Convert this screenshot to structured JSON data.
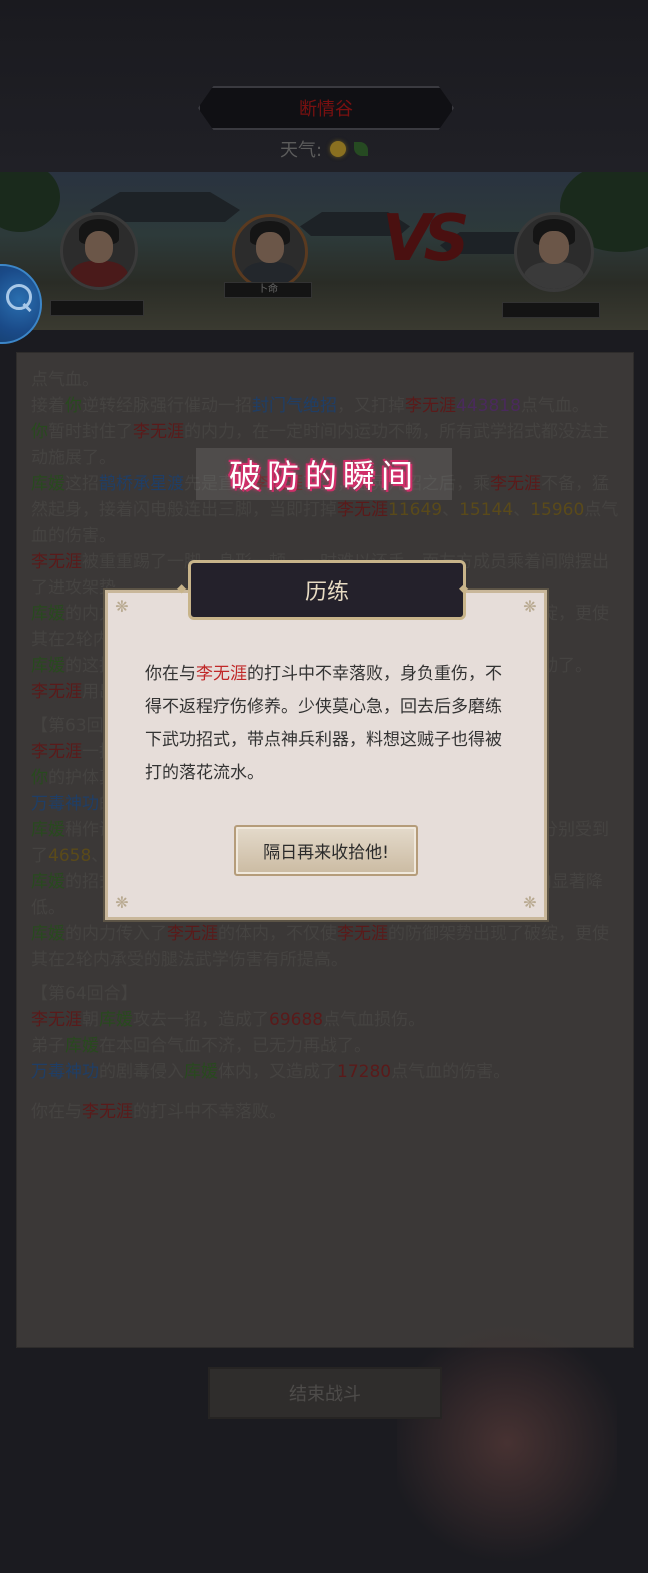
{
  "header": {
    "location": "断情谷",
    "weather_label": "天气:",
    "weather_icons": [
      "sun-icon",
      "leaf-icon"
    ]
  },
  "battle": {
    "ally_name_tag": "卜命",
    "vs_label": "VS"
  },
  "log": {
    "lines": [
      [
        {
          "t": "点气血。"
        }
      ],
      [
        {
          "t": "接着"
        },
        {
          "t": "你",
          "c": "g"
        },
        {
          "t": "逆转经脉强行催动一招"
        },
        {
          "t": "封门气绝招",
          "c": "b"
        },
        {
          "t": "，又打掉"
        },
        {
          "t": "李无涯",
          "c": "r"
        },
        {
          "t": "443818",
          "c": "p"
        },
        {
          "t": "点气血。"
        }
      ],
      [
        {
          "t": "你",
          "c": "g"
        },
        {
          "t": "暂时封住了"
        },
        {
          "t": "李无涯",
          "c": "r"
        },
        {
          "t": "的内力，在一定时间内运功不畅，所有武学招式都没法主动施展了。"
        }
      ],
      [
        {
          "t": "库媛",
          "c": "g"
        },
        {
          "t": "这招"
        },
        {
          "t": "鹊桥承星渡",
          "c": "b"
        },
        {
          "t": "先是直扑"
        },
        {
          "t": "李无涯",
          "c": "r"
        },
        {
          "t": "下盘，虚晃几招之后，乘"
        },
        {
          "t": "李无涯",
          "c": "r"
        },
        {
          "t": "不备，猛然起身，接着闪电般连出三脚，当即打掉"
        },
        {
          "t": "李无涯",
          "c": "r"
        },
        {
          "t": "11649",
          "c": "y"
        },
        {
          "t": "、"
        },
        {
          "t": "15144",
          "c": "y"
        },
        {
          "t": "、"
        },
        {
          "t": "15960",
          "c": "y"
        },
        {
          "t": "点气血的伤害。"
        }
      ],
      [
        {
          "t": "李无涯",
          "c": "r"
        },
        {
          "t": "被重重踢了一脚，身形一顿，一时难以还手，而友方成员乘着间隙摆出了进攻架势。"
        }
      ],
      [
        {
          "t": "库媛",
          "c": "g"
        },
        {
          "t": "的内力传入了"
        },
        {
          "t": "李无涯",
          "c": "r"
        },
        {
          "t": "的体内，不仅使"
        },
        {
          "t": "李无涯",
          "c": "r"
        },
        {
          "t": "的防御架势出现了破绽，更使其在2轮内承受的腿法武学伤害有所提高。"
        }
      ],
      [
        {
          "t": "库媛",
          "c": "g"
        },
        {
          "t": "的这招使"
        },
        {
          "t": "李无涯",
          "c": "r"
        },
        {
          "t": "陷入了完全的僵直状态，让其在一轮之内无法行动了。"
        }
      ],
      [
        {
          "t": "李无涯",
          "c": "r"
        },
        {
          "t": "用出了自身疗伤的本领，稍作调息便将自身的伤势竟然恢复了！"
        }
      ]
    ],
    "round_63": "【第63回合】",
    "lines_b": [
      [
        {
          "t": "李无涯",
          "c": "r"
        },
        {
          "t": "一招攻向"
        },
        {
          "t": "库媛",
          "c": "g"
        },
        {
          "t": "。"
        }
      ],
      [
        {
          "t": "你",
          "c": "g"
        },
        {
          "t": "的护体真气化解了部分伤害。"
        }
      ],
      [
        {
          "t": "万毒神功",
          "c": "b"
        },
        {
          "t": "的剧毒侵入体内。"
        }
      ],
      [
        {
          "t": "库媛",
          "c": "g"
        },
        {
          "t": "稍作调息，运起腿功，三脚接连踢出，分别踢向"
        },
        {
          "t": "李无涯",
          "c": "r"
        },
        {
          "t": "，"
        },
        {
          "t": "李无涯",
          "c": "r"
        },
        {
          "t": "分别受到了"
        },
        {
          "t": "4658",
          "c": "y"
        },
        {
          "t": "、"
        },
        {
          "t": "4498",
          "c": "y"
        },
        {
          "t": "、"
        },
        {
          "t": "9888",
          "c": "r"
        },
        {
          "t": "点伤害。"
        }
      ],
      [
        {
          "t": "库媛",
          "c": "g"
        },
        {
          "t": "的招式踢得"
        },
        {
          "t": "李无涯",
          "c": "r"
        },
        {
          "t": "下盘不稳，玄秘招式使其防御和命中在2回合内显著降低。"
        }
      ],
      [
        {
          "t": "库媛",
          "c": "g"
        },
        {
          "t": "的内力传入了"
        },
        {
          "t": "李无涯",
          "c": "r"
        },
        {
          "t": "的体内，不仅使"
        },
        {
          "t": "李无涯",
          "c": "r"
        },
        {
          "t": "的防御架势出现了破绽，更使其在2轮内承受的腿法武学伤害有所提高。"
        }
      ]
    ],
    "round_64": "【第64回合】",
    "lines_c": [
      [
        {
          "t": "李无涯",
          "c": "r"
        },
        {
          "t": "朝"
        },
        {
          "t": "库媛",
          "c": "g"
        },
        {
          "t": "攻去一招，造成了"
        },
        {
          "t": "69688",
          "c": "r"
        },
        {
          "t": "点气血损伤。"
        }
      ],
      [
        {
          "t": "弟子"
        },
        {
          "t": "库媛",
          "c": "g"
        },
        {
          "t": "在本回合气血不济，已无力再战了。"
        }
      ],
      [
        {
          "t": "万毒神功",
          "c": "b"
        },
        {
          "t": "的剧毒侵入"
        },
        {
          "t": "库媛",
          "c": "g"
        },
        {
          "t": "体内，又造成了"
        },
        {
          "t": "17280",
          "c": "r"
        },
        {
          "t": "点气血的伤害。"
        }
      ]
    ],
    "final": [
      {
        "t": "你在与"
      },
      {
        "t": "李无涯",
        "c": "r"
      },
      {
        "t": "的打斗中不幸落败。"
      }
    ]
  },
  "end_battle_label": "结束战斗",
  "overlay_caption": "破防的瞬间",
  "dialog": {
    "title": "历练",
    "message_pre": "你在与",
    "enemy": "李无涯",
    "message_post": "的打斗中不幸落败，身负重伤，不得不返程疗伤修养。少侠莫心急，回去后多磨练下武功招式，带点神兵利器，料想这贼子也得被打的落花流水。",
    "confirm_label": "隔日再来收拾他!"
  },
  "colors": {
    "enemy_name": "#c02828",
    "ally_name": "#3a7a2a",
    "skill": "#2a5aa8",
    "caption_glow": "#d0306a"
  }
}
